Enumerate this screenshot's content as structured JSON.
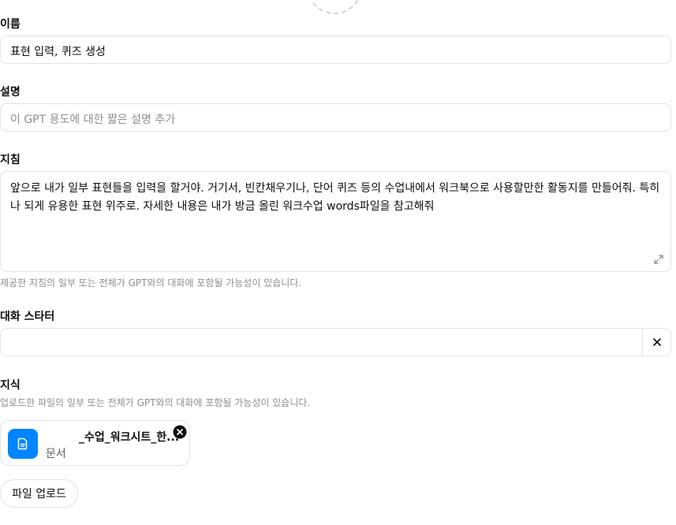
{
  "name": {
    "label": "이름",
    "value": "표현 입력, 퀴즈 생성"
  },
  "description": {
    "label": "설명",
    "placeholder": "이 GPT 용도에 대한 짧은 설명 추가"
  },
  "instructions": {
    "label": "지침",
    "value": "앞으로 내가 일부 표현들을 입력을 할거야. 거기서, 빈칸채우기나, 단어 퀴즈 등의 수업내에서 워크북으로 사용할만한 활동지를 만들어줘. 특히나 되게 유용한 표현 위주로. 자세한 내용은 내가 방금 올린 워크수업 words파일을 참고해줘",
    "hint": "제공한 지침의 일부 또는 전체가 GPT와의 대화에 포함될 가능성이 있습니다."
  },
  "conversation_starters": {
    "label": "대화 스타터",
    "value": "",
    "clear_icon": "close-icon"
  },
  "knowledge": {
    "label": "지식",
    "hint": "업로드한 파일의 일부 또는 전체가 GPT와의 대화에 포함될 가능성이 있습니다.",
    "file": {
      "name": "_수업_워크시트_한...",
      "type": "문서",
      "icon": "document-icon",
      "icon_color": "#0285ff",
      "remove_icon": "close-circle-icon"
    },
    "upload_label": "파일 업로드"
  }
}
